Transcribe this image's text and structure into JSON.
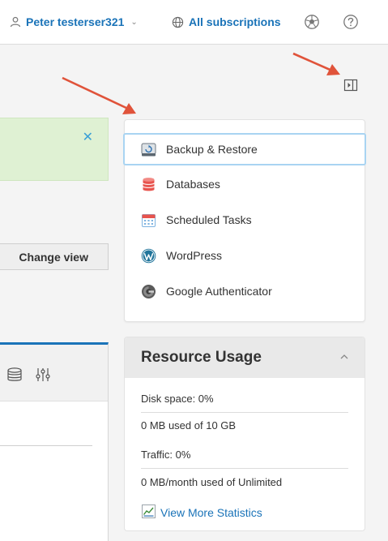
{
  "header": {
    "user_name": "Peter testerser321",
    "subscriptions_label": "All subscriptions",
    "icons": [
      "user-icon",
      "globe-icon",
      "soccer-ball-icon",
      "help-icon"
    ]
  },
  "main": {
    "change_view_label": "Change view",
    "banner_close": "✕"
  },
  "apps": {
    "items": [
      {
        "label": "Backup & Restore",
        "icon": "backup-restore-icon",
        "selected": true
      },
      {
        "label": "Databases",
        "icon": "databases-icon",
        "selected": false
      },
      {
        "label": "Scheduled Tasks",
        "icon": "scheduled-tasks-icon",
        "selected": false
      },
      {
        "label": "WordPress",
        "icon": "wordpress-icon",
        "selected": false
      },
      {
        "label": "Google Authenticator",
        "icon": "google-authenticator-icon",
        "selected": false
      }
    ]
  },
  "resource_usage": {
    "title": "Resource Usage",
    "disk_label": "Disk space: 0%",
    "disk_detail": "0 MB used of 10 GB",
    "traffic_label": "Traffic: 0%",
    "traffic_detail": "0 MB/month used of Unlimited",
    "stats_link": "View More Statistics",
    "disk_percent": 0,
    "traffic_percent": 0
  },
  "colors": {
    "link_blue": "#1a73b8",
    "success_bg": "#dff1d3",
    "selection_outline": "#a9d4f2",
    "annotation_arrow": "#e0533a"
  }
}
